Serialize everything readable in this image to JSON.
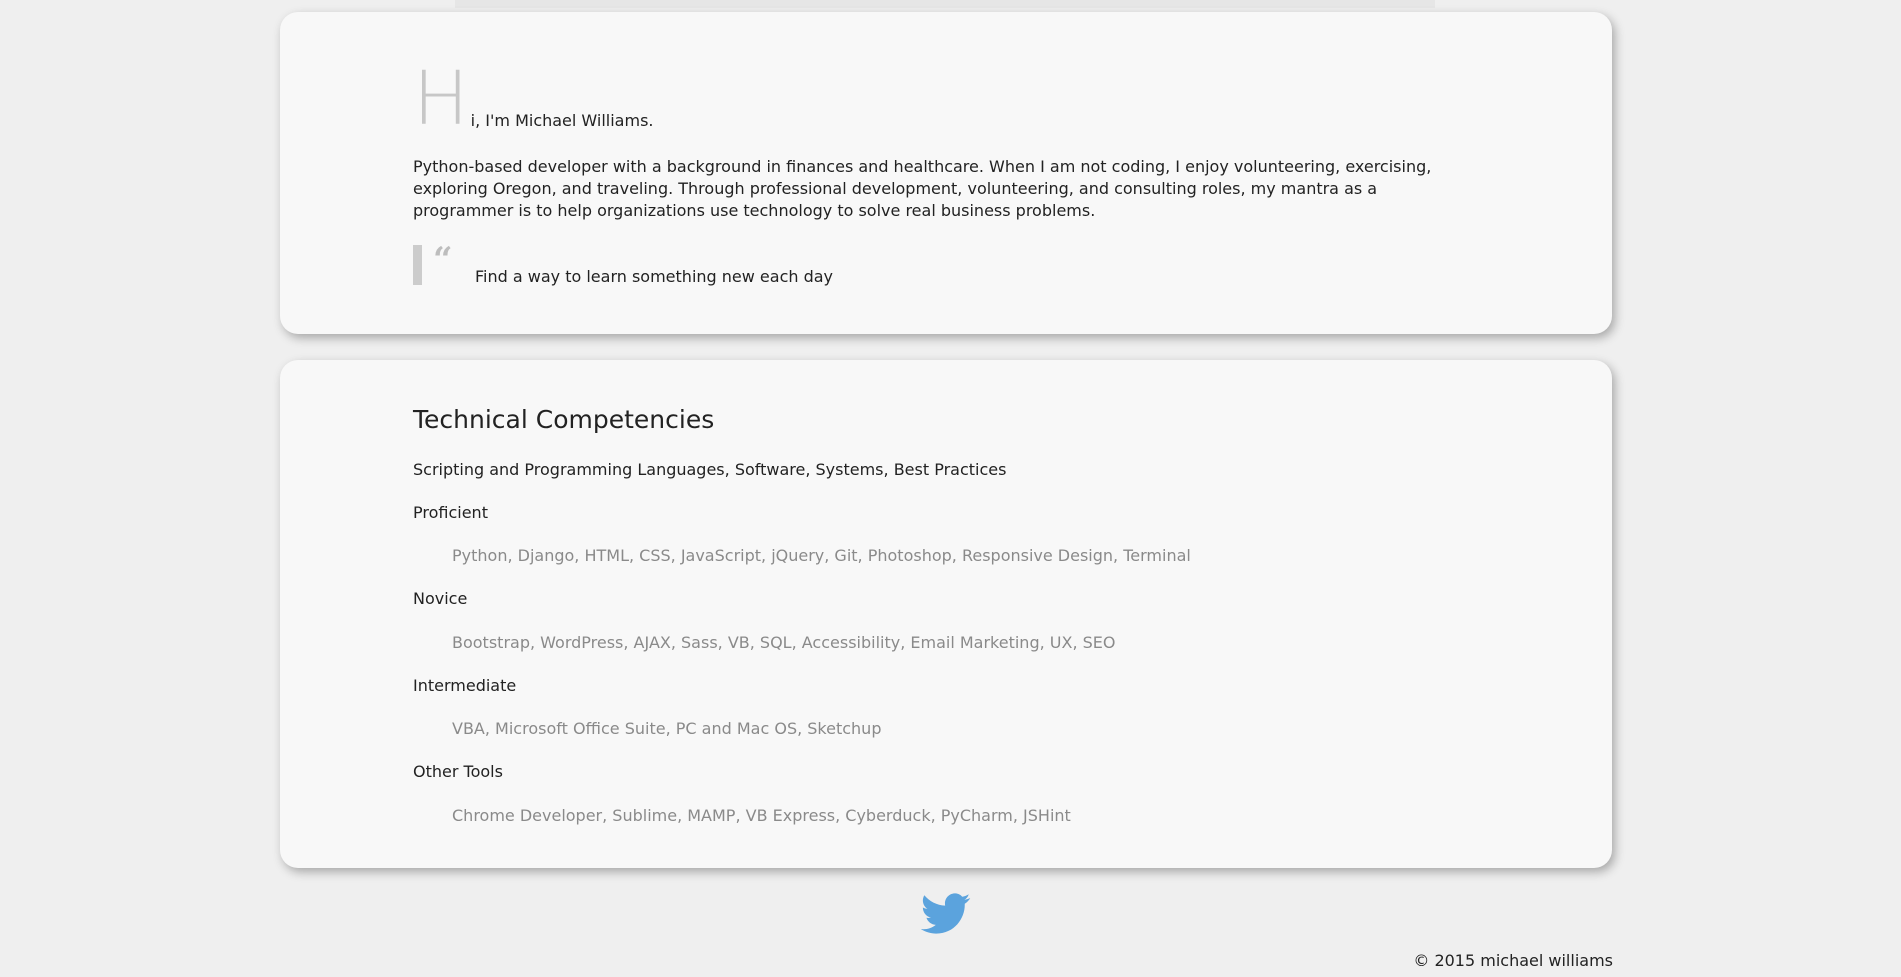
{
  "intro": {
    "dropcap": "H",
    "greeting_rest": "i, I'm Michael Williams.",
    "bio": "Python-based developer with a background in finances and healthcare. When I am not coding, I enjoy volunteering, exercising, exploring Oregon, and traveling. Through professional development, volunteering, and consulting roles, my mantra as a programmer is to help organizations use technology to solve real business problems.",
    "quote_mark": "“",
    "quote": "Find a way to learn something new each day"
  },
  "skills": {
    "title": "Technical Competencies",
    "subtitle": "Scripting and Programming Languages, Software, Systems, Best Practices",
    "groups": [
      {
        "label": "Proficient",
        "items": "Python, Django, HTML, CSS, JavaScript, jQuery, Git, Photoshop, Responsive Design, Terminal"
      },
      {
        "label": "Novice",
        "items": "Bootstrap, WordPress, AJAX, Sass, VB, SQL, Accessibility, Email Marketing, UX, SEO"
      },
      {
        "label": "Intermediate",
        "items": "VBA, Microsoft Office Suite, PC and Mac OS, Sketchup"
      },
      {
        "label": "Other Tools",
        "items": "Chrome Developer, Sublime, MAMP, VB Express, Cyberduck, PyCharm, JSHint"
      }
    ]
  },
  "social": {
    "icon": "twitter-icon",
    "color": "#5ba3dd"
  },
  "footer": {
    "copyright": "© 2015 michael williams"
  }
}
